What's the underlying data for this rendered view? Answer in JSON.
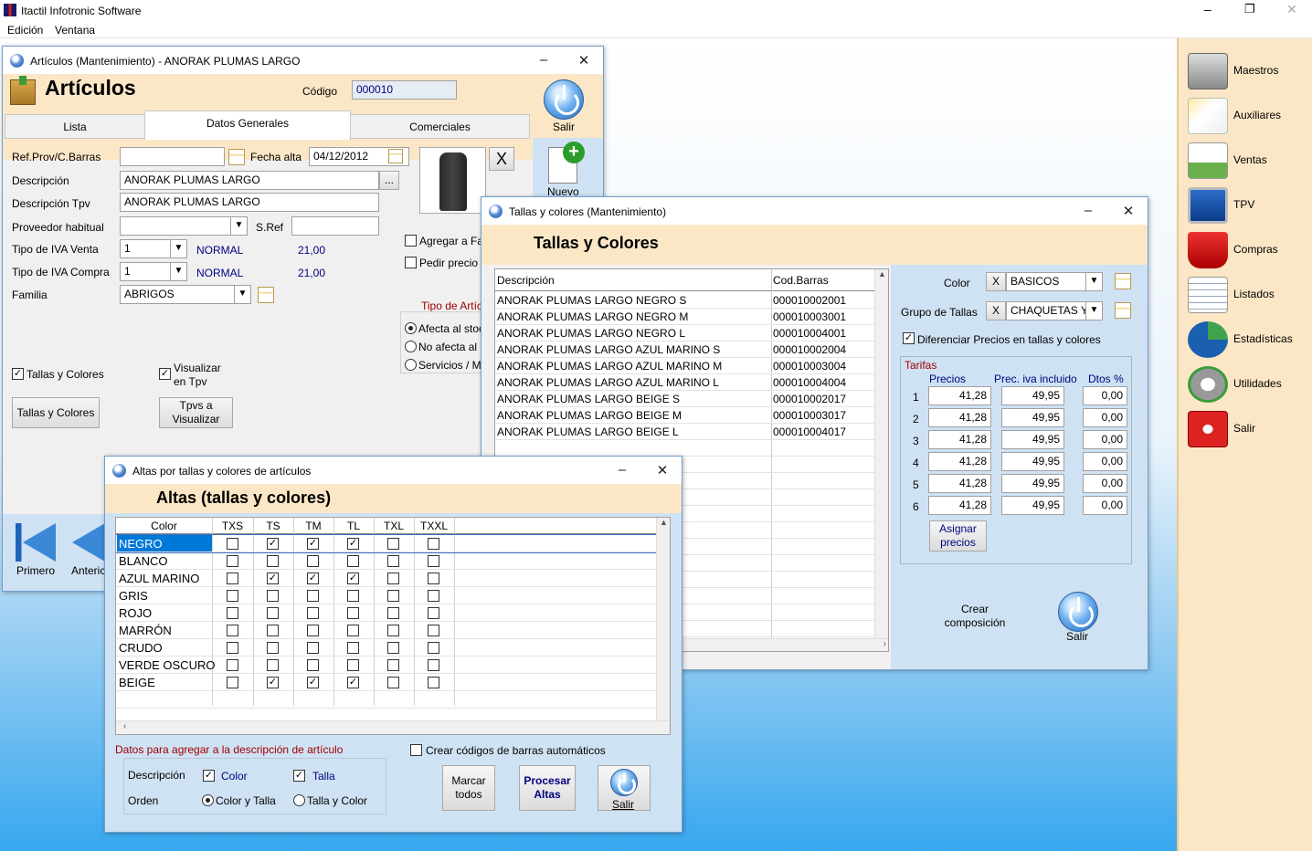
{
  "app": {
    "title": "Itactil Infotronic Software",
    "menu": [
      "Edición",
      "Ventana"
    ],
    "controls": [
      "–",
      "❐",
      "✕"
    ]
  },
  "sidebar": {
    "items": [
      {
        "label": "Maestros",
        "icon": "server-icon"
      },
      {
        "label": "Auxiliares",
        "icon": "notes-icon"
      },
      {
        "label": "Ventas",
        "icon": "sales-chart-icon"
      },
      {
        "label": "TPV",
        "icon": "pos-computer-icon"
      },
      {
        "label": "Compras",
        "icon": "shopping-cart-icon"
      },
      {
        "label": "Listados",
        "icon": "list-icon"
      },
      {
        "label": "Estadísticas",
        "icon": "pie-chart-icon"
      },
      {
        "label": "Utilidades",
        "icon": "gear-icon"
      },
      {
        "label": "Salir",
        "icon": "power-icon"
      }
    ]
  },
  "articulos": {
    "window_title": "Artículos (Mantenimiento) - ANORAK PLUMAS LARGO",
    "heading": "Artículos",
    "codigo_label": "Código",
    "codigo": "000010",
    "salir": "Salir",
    "nuevo": "Nuevo",
    "tabs": [
      "Lista",
      "Datos Generales",
      "Comerciales"
    ],
    "ref_label": "Ref.Prov/C.Barras",
    "ref": "",
    "fecha_label": "Fecha alta",
    "fecha": "04/12/2012",
    "desc_label": "Descripción",
    "desc": "ANORAK PLUMAS LARGO",
    "desc_btn": "...",
    "desctpv_label": "Descripción Tpv",
    "desctpv": "ANORAK PLUMAS LARGO",
    "prov_label": "Proveedor habitual",
    "prov": "",
    "sref_label": "S.Ref",
    "sref": "",
    "ivav_label": "Tipo de IVA Venta",
    "ivav": "1",
    "ivav_type": "NORMAL",
    "ivav_pct": "21,00",
    "ivac_label": "Tipo de IVA Compra",
    "ivac": "1",
    "ivac_type": "NORMAL",
    "ivac_pct": "21,00",
    "familia_label": "Familia",
    "familia": "ABRIGOS",
    "img_clear": "X",
    "agregar": "Agregar a Fa",
    "pedir": "Pedir precio",
    "tipo_label": "Tipo de Artíc",
    "radios": [
      "Afecta al stoc",
      "No afecta al",
      "Servicios / M"
    ],
    "tallas_chk": "Tallas y Colores",
    "visualizar_chk1": "Visualizar",
    "visualizar_chk2": "en Tpv",
    "tallas_btn": "Tallas y Colores",
    "tpvs_btn1": "Tpvs a",
    "tpvs_btn2": "Visualizar",
    "nav_primero": "Primero",
    "nav_anterior": "Anteric"
  },
  "tallas": {
    "window_title": "Tallas y colores (Mantenimiento)",
    "heading": "Tallas y Colores",
    "col_desc": "Descripción",
    "col_cod": "Cod.Barras",
    "rows": [
      [
        "ANORAK PLUMAS LARGO NEGRO S",
        "000010002001"
      ],
      [
        "ANORAK PLUMAS LARGO NEGRO M",
        "000010003001"
      ],
      [
        "ANORAK PLUMAS LARGO NEGRO L",
        "000010004001"
      ],
      [
        "ANORAK PLUMAS LARGO AZUL MARINO S",
        "000010002004"
      ],
      [
        "ANORAK PLUMAS LARGO AZUL MARINO M",
        "000010003004"
      ],
      [
        "ANORAK PLUMAS LARGO AZUL MARINO L",
        "000010004004"
      ],
      [
        "ANORAK PLUMAS LARGO BEIGE S",
        "000010002017"
      ],
      [
        "ANORAK PLUMAS LARGO BEIGE M",
        "000010003017"
      ],
      [
        "ANORAK PLUMAS LARGO BEIGE L",
        "000010004017"
      ]
    ],
    "color_label": "Color",
    "color_x": "X",
    "color": "BASICOS",
    "grupo_label": "Grupo de Tallas",
    "grupo_x": "X",
    "grupo": "CHAQUETAS Y",
    "dif_label": "Diferenciar Precios en tallas y colores",
    "tarifas": "Tarifas",
    "h_precios": "Precios",
    "h_iva": "Prec. iva incluido",
    "h_dtos": "Dtos %",
    "tarifas_rows": [
      [
        "1",
        "41,28",
        "49,95",
        "0,00"
      ],
      [
        "2",
        "41,28",
        "49,95",
        "0,00"
      ],
      [
        "3",
        "41,28",
        "49,95",
        "0,00"
      ],
      [
        "4",
        "41,28",
        "49,95",
        "0,00"
      ],
      [
        "5",
        "41,28",
        "49,95",
        "0,00"
      ],
      [
        "6",
        "41,28",
        "49,95",
        "0,00"
      ]
    ],
    "asignar1": "Asignar",
    "asignar2": "precios",
    "crear1": "Crear",
    "crear2": "composición",
    "salir": "Salir"
  },
  "altas": {
    "window_title": "Altas por tallas y colores de artículos",
    "heading": "Altas (tallas y colores)",
    "cols": [
      "Color",
      "TXS",
      "TS",
      "TM",
      "TL",
      "TXL",
      "TXXL"
    ],
    "rows": [
      {
        "color": "NEGRO",
        "checks": [
          false,
          true,
          true,
          true,
          false,
          false
        ]
      },
      {
        "color": "BLANCO",
        "checks": [
          false,
          false,
          false,
          false,
          false,
          false
        ]
      },
      {
        "color": "AZUL MARINO",
        "checks": [
          false,
          true,
          true,
          true,
          false,
          false
        ]
      },
      {
        "color": "GRIS",
        "checks": [
          false,
          false,
          false,
          false,
          false,
          false
        ]
      },
      {
        "color": "ROJO",
        "checks": [
          false,
          false,
          false,
          false,
          false,
          false
        ]
      },
      {
        "color": "MARRÓN",
        "checks": [
          false,
          false,
          false,
          false,
          false,
          false
        ]
      },
      {
        "color": "CRUDO",
        "checks": [
          false,
          false,
          false,
          false,
          false,
          false
        ]
      },
      {
        "color": "VERDE OSCURO",
        "checks": [
          false,
          false,
          false,
          false,
          false,
          false
        ]
      },
      {
        "color": "BEIGE",
        "checks": [
          false,
          true,
          true,
          true,
          false,
          false
        ]
      }
    ],
    "datos_label": "Datos para agregar a  la descripción de artículo",
    "crear_codigos": "Crear códigos de barras automáticos",
    "desc_label": "Descripción",
    "chk_color": "Color",
    "chk_talla": "Talla",
    "orden_label": "Orden",
    "radio_ct": "Color y Talla",
    "radio_tc": "Talla y Color",
    "marcar1": "Marcar",
    "marcar2": "todos",
    "procesar1": "Procesar",
    "procesar2": "Altas",
    "salir": "Salir"
  }
}
